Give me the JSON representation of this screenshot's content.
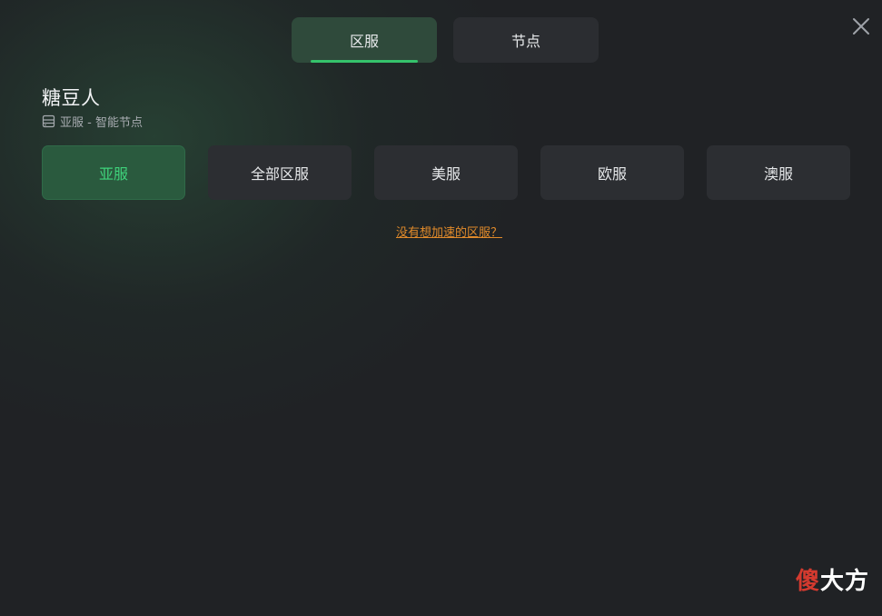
{
  "tabs": [
    {
      "label": "区服",
      "active": true
    },
    {
      "label": "节点",
      "active": false
    }
  ],
  "game": {
    "title": "糖豆人",
    "subtitle": "亚服 - 智能节点"
  },
  "regions": [
    {
      "label": "亚服",
      "selected": true
    },
    {
      "label": "全部区服",
      "selected": false
    },
    {
      "label": "美服",
      "selected": false
    },
    {
      "label": "欧服",
      "selected": false
    },
    {
      "label": "澳服",
      "selected": false
    }
  ],
  "missing_region_link": "没有想加速的区服？",
  "watermark": {
    "first": "傻",
    "rest": "大方"
  },
  "colors": {
    "accent": "#35c26b",
    "selected_text": "#3fd27b",
    "link": "#e08a2a",
    "background": "#202225"
  },
  "icons": {
    "close": "close-icon",
    "server": "server-icon"
  }
}
